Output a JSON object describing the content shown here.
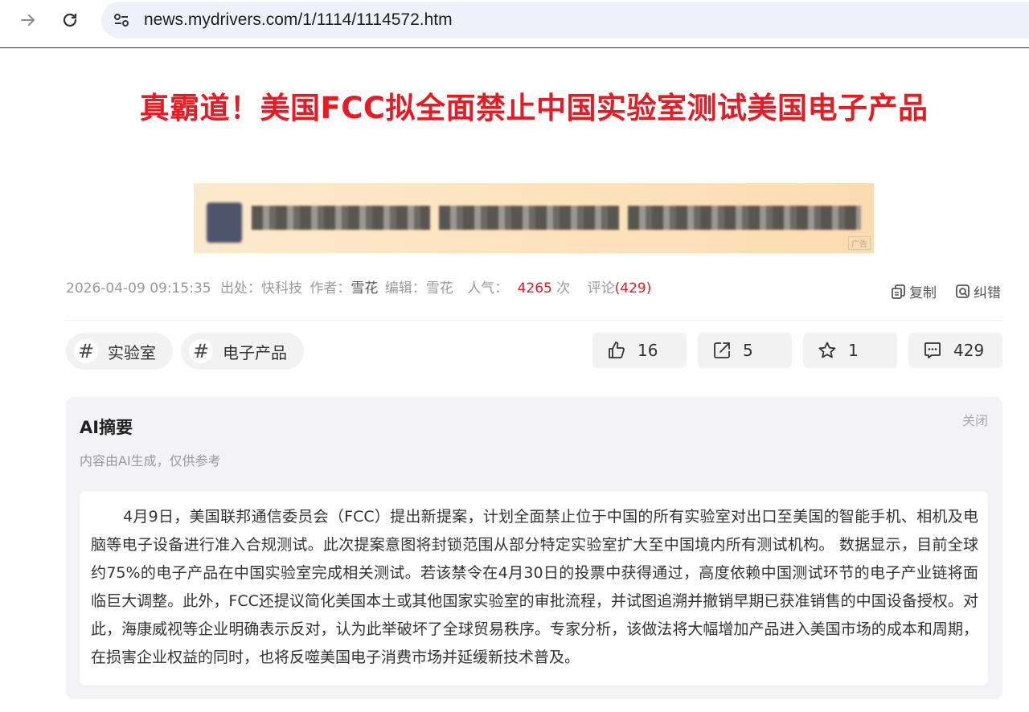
{
  "browser": {
    "url": "news.mydrivers.com/1/1114/1114572.htm",
    "icons": {
      "back": "arrow-right-icon",
      "reload": "reload-icon",
      "site_info": "site-settings-icon"
    }
  },
  "article": {
    "title": "真霸道！美国FCC拟全面禁止中国实验室测试美国电子产品",
    "ad_tag": "广告",
    "meta": {
      "datetime": "2026-04-09 09:15:35",
      "source_label": "出处：快科技",
      "author_label": "作者：",
      "author": "雪花",
      "editor_label": "编辑：雪花",
      "popularity_label": "人气：",
      "popularity": "4265",
      "popularity_unit": "次",
      "comment_label": "评论",
      "comment_count": "(429)"
    },
    "tools": {
      "copy": "复制",
      "report": "纠错"
    },
    "tags": [
      {
        "label": "实验室"
      },
      {
        "label": "电子产品"
      }
    ],
    "tag_symbol": "#",
    "actions": {
      "likes": "16",
      "shares": "5",
      "favorites": "1",
      "comments": "429"
    },
    "ai_summary": {
      "title": "AI摘要",
      "subtitle": "内容由AI生成，仅供参考",
      "close": "关闭",
      "text": "4月9日，美国联邦通信委员会（FCC）提出新提案，计划全面禁止位于中国的所有实验室对出口至美国的智能手机、相机及电脑等电子设备进行准入合规测试。此次提案意图将封锁范围从部分特定实验室扩大至中国境内所有测试机构。 数据显示，目前全球约75%的电子产品在中国实验室完成相关测试。若该禁令在4月30日的投票中获得通过，高度依赖中国测试环节的电子产业链将面临巨大调整。此外，FCC还提议简化美国本土或其他国家实验室的审批流程，并试图追溯并撤销早期已获准销售的中国设备授权。对此，海康威视等企业明确表示反对，认为此举破坏了全球贸易秩序。专家分析，该做法将大幅增加产品进入美国市场的成本和周期，在损害企业权益的同时，也将反噬美国电子消费市场并延缓新技术普及。"
    }
  }
}
